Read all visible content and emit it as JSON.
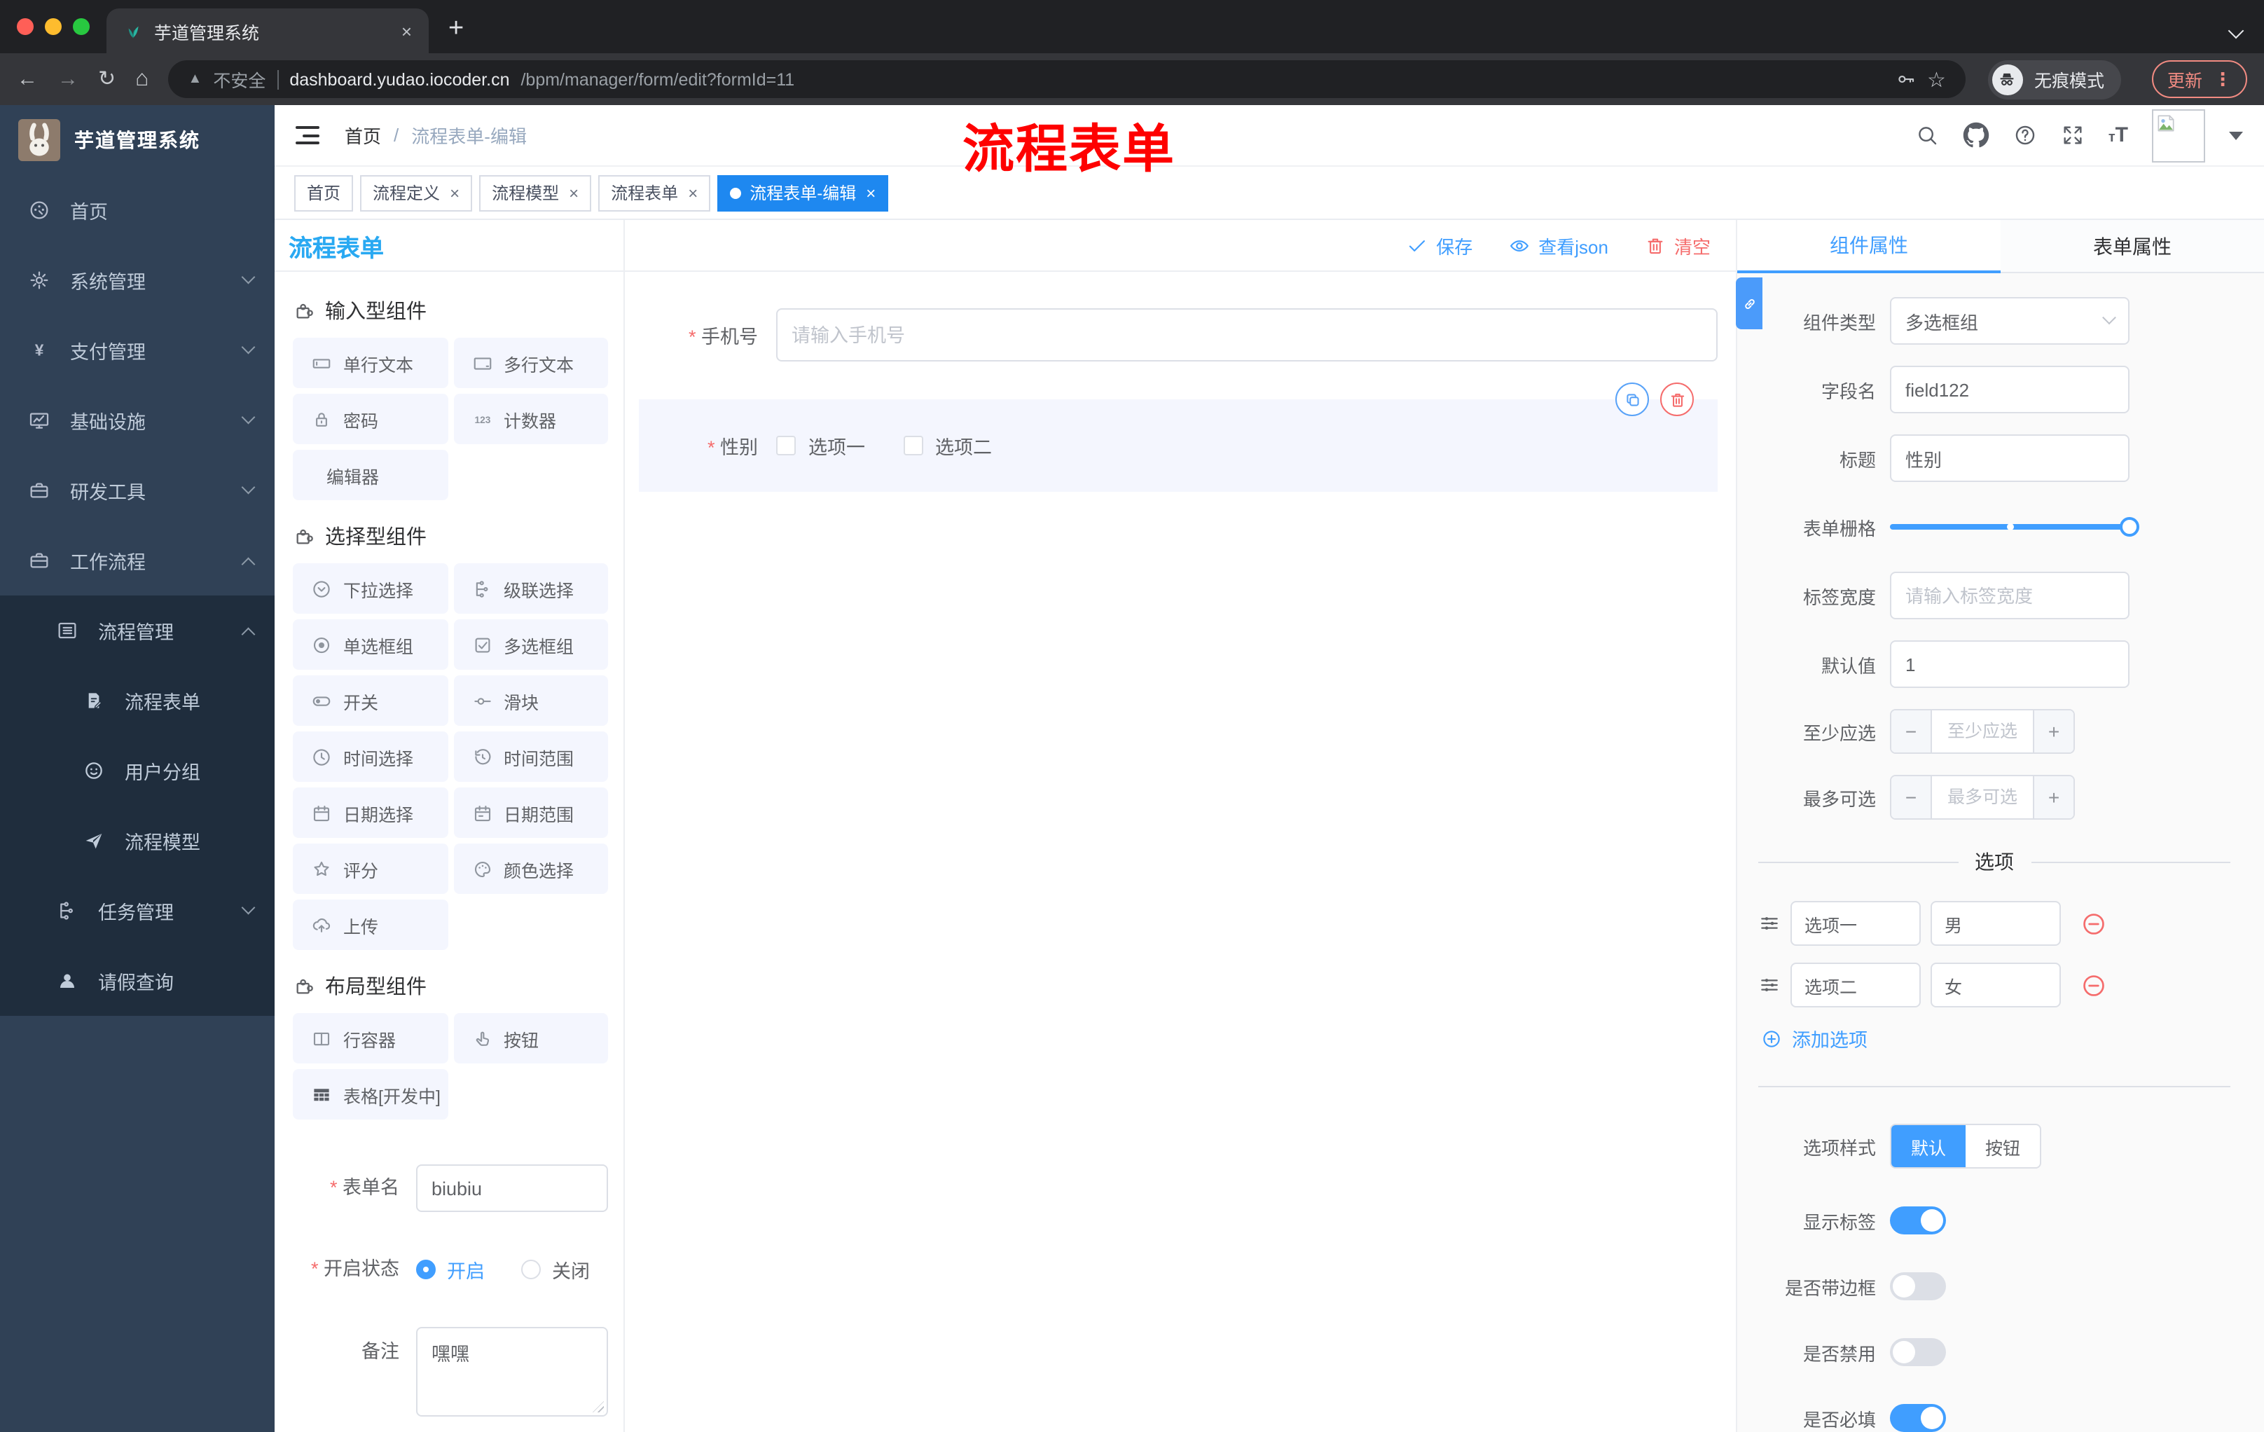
{
  "browser": {
    "tab_title": "芋道管理系统",
    "close_tab": "×",
    "new_tab": "+",
    "back": "←",
    "forward": "→",
    "reload": "↻",
    "home": "⌂",
    "security_label": "不安全",
    "url_host": "dashboard.yudao.iocoder.cn",
    "url_path": "/bpm/manager/form/edit?formId=11",
    "incognito_label": "无痕模式",
    "update_label": "更新",
    "more_dots": "⋮"
  },
  "sidebar": {
    "logo_title": "芋道管理系统",
    "items": [
      {
        "label": "首页"
      },
      {
        "label": "系统管理"
      },
      {
        "label": "支付管理"
      },
      {
        "label": "基础设施"
      },
      {
        "label": "研发工具"
      },
      {
        "label": "工作流程"
      }
    ],
    "submenu": {
      "process_manage": {
        "label": "流程管理"
      },
      "children": [
        {
          "label": "流程表单"
        },
        {
          "label": "用户分组"
        },
        {
          "label": "流程模型"
        }
      ],
      "task_manage": {
        "label": "任务管理"
      },
      "leave_query": {
        "label": "请假查询"
      }
    }
  },
  "header": {
    "breadcrumb": {
      "home": "首页",
      "separator": "/",
      "current": "流程表单-编辑"
    },
    "annotation": "流程表单"
  },
  "tags": [
    {
      "label": "首页"
    },
    {
      "label": "流程定义"
    },
    {
      "label": "流程模型"
    },
    {
      "label": "流程表单"
    },
    {
      "label": "流程表单-编辑"
    }
  ],
  "left_panel": {
    "title": "流程表单",
    "sections": [
      {
        "title": "输入型组件",
        "items": [
          {
            "label": "单行文本"
          },
          {
            "label": "多行文本"
          },
          {
            "label": "密码"
          },
          {
            "label": "计数器"
          },
          {
            "label": "编辑器"
          }
        ]
      },
      {
        "title": "选择型组件",
        "items": [
          {
            "label": "下拉选择"
          },
          {
            "label": "级联选择"
          },
          {
            "label": "单选框组"
          },
          {
            "label": "多选框组"
          },
          {
            "label": "开关"
          },
          {
            "label": "滑块"
          },
          {
            "label": "时间选择"
          },
          {
            "label": "时间范围"
          },
          {
            "label": "日期选择"
          },
          {
            "label": "日期范围"
          },
          {
            "label": "评分"
          },
          {
            "label": "颜色选择"
          },
          {
            "label": "上传"
          }
        ]
      },
      {
        "title": "布局型组件",
        "items": [
          {
            "label": "行容器"
          },
          {
            "label": "按钮"
          },
          {
            "label": "表格[开发中]"
          }
        ]
      }
    ],
    "meta": {
      "name_label": "表单名",
      "name_value": "biubiu",
      "status_label": "开启状态",
      "status_on": "开启",
      "status_off": "关闭",
      "remark_label": "备注",
      "remark_value": "嘿嘿"
    }
  },
  "canvas": {
    "toolbar": {
      "save": "保存",
      "view_json": "查看json",
      "clear": "清空"
    },
    "phone_field": {
      "label": "手机号",
      "placeholder": "请输入手机号"
    },
    "gender_field": {
      "label": "性别",
      "option1": "选项一",
      "option2": "选项二"
    }
  },
  "properties": {
    "tab_component": "组件属性",
    "tab_form": "表单属性",
    "component_type": {
      "label": "组件类型",
      "value": "多选框组"
    },
    "field_name": {
      "label": "字段名",
      "value": "field122"
    },
    "title": {
      "label": "标题",
      "value": "性别"
    },
    "grid": {
      "label": "表单栅格"
    },
    "label_width": {
      "label": "标签宽度",
      "placeholder": "请输入标签宽度"
    },
    "default_value": {
      "label": "默认值",
      "value": "1"
    },
    "min_select": {
      "label": "至少应选",
      "placeholder": "至少应选",
      "minus": "−",
      "plus": "+"
    },
    "max_select": {
      "label": "最多可选",
      "placeholder": "最多可选",
      "minus": "−",
      "plus": "+"
    },
    "options": {
      "divider": "选项",
      "rows": [
        {
          "name": "选项一",
          "value": "男"
        },
        {
          "name": "选项二",
          "value": "女"
        }
      ],
      "add_label": "添加选项"
    },
    "option_style": {
      "label": "选项样式",
      "default": "默认",
      "button": "按钮"
    },
    "show_label": {
      "label": "显示标签"
    },
    "with_border": {
      "label": "是否带边框"
    },
    "disabled": {
      "label": "是否禁用"
    },
    "required": {
      "label": "是否必填"
    }
  },
  "colors": {
    "primary": "#409EFF",
    "danger": "#F56C6C",
    "tag_active": "#1E88F0",
    "annotation": "#FE0100"
  }
}
